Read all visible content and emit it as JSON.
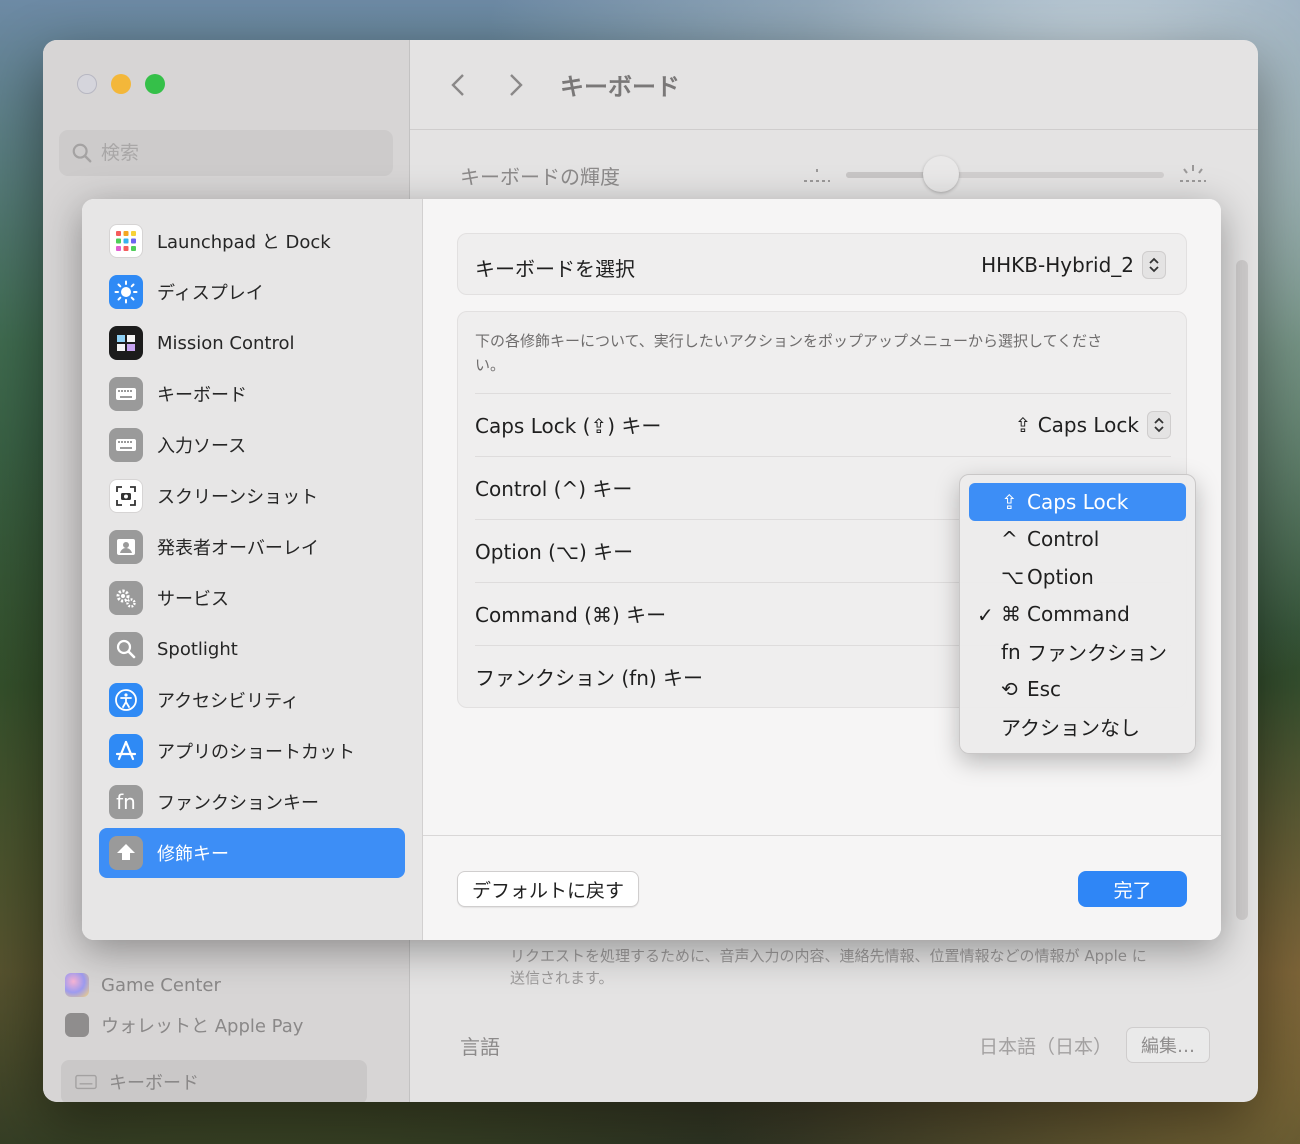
{
  "window": {
    "title": "キーボード",
    "search_placeholder": "検索",
    "brightness_label": "キーボードの輝度",
    "brightness_level": 0.3,
    "privacy_text": "リクエストを処理するために、音声入力の内容、連絡先情報、位置情報などの情報が Apple に送信されます。",
    "language_label": "言語",
    "language_value": "日本語（日本）",
    "edit_button": "編集…",
    "sidebar_items": [
      {
        "label": "Game Center",
        "icon": "game-center-icon"
      },
      {
        "label": "ウォレットと Apple Pay",
        "icon": "wallet-icon"
      }
    ],
    "sidebar_current": "キーボード"
  },
  "sheet": {
    "sidebar": [
      {
        "label": "Launchpad と Dock",
        "icon": "launchpad-icon",
        "color": "#ffffff"
      },
      {
        "label": "ディスプレイ",
        "icon": "display-icon",
        "color": "#2f8af5"
      },
      {
        "label": "Mission Control",
        "icon": "mission-control-icon",
        "color": "#1c1c1c"
      },
      {
        "label": "キーボード",
        "icon": "keyboard-icon",
        "color": "#9a9a9a"
      },
      {
        "label": "入力ソース",
        "icon": "input-source-icon",
        "color": "#9a9a9a"
      },
      {
        "label": "スクリーンショット",
        "icon": "screenshot-icon",
        "color": "#ffffff"
      },
      {
        "label": "発表者オーバーレイ",
        "icon": "presenter-overlay-icon",
        "color": "#9a9a9a"
      },
      {
        "label": "サービス",
        "icon": "services-icon",
        "color": "#9a9a9a"
      },
      {
        "label": "Spotlight",
        "icon": "spotlight-icon",
        "color": "#9a9a9a"
      },
      {
        "label": "アクセシビリティ",
        "icon": "accessibility-icon",
        "color": "#2f8af5"
      },
      {
        "label": "アプリのショートカット",
        "icon": "app-shortcuts-icon",
        "color": "#2f8af5"
      },
      {
        "label": "ファンクションキー",
        "icon": "fn-icon",
        "color": "#9a9a9a"
      },
      {
        "label": "修飾キー",
        "icon": "modifier-keys-icon",
        "color": "#9a9a9a",
        "active": true
      }
    ],
    "keyboard_select_label": "キーボードを選択",
    "keyboard_select_value": "HHKB-Hybrid_2",
    "description": "下の各修飾キーについて、実行したいアクションをポップアップメニューから選択してください。",
    "modifier_rows": [
      {
        "label": "Caps Lock (⇪) キー",
        "value": "⇪ Caps Lock"
      },
      {
        "label": "Control (^) キー",
        "value": ""
      },
      {
        "label": "Option (⌥) キー",
        "value": ""
      },
      {
        "label": "Command (⌘) キー",
        "value": ""
      },
      {
        "label": "ファンクション (fn) キー",
        "value": ""
      }
    ],
    "restore_defaults_button": "デフォルトに戻す",
    "done_button": "完了"
  },
  "menu": {
    "items": [
      {
        "glyph": "⇪",
        "label": "Caps Lock",
        "highlighted": true,
        "checked": false
      },
      {
        "glyph": "^",
        "label": "Control",
        "highlighted": false,
        "checked": false
      },
      {
        "glyph": "⌥",
        "label": "Option",
        "highlighted": false,
        "checked": false
      },
      {
        "glyph": "⌘",
        "label": "Command",
        "highlighted": false,
        "checked": true
      },
      {
        "glyph": "fn",
        "label": "ファンクション",
        "highlighted": false,
        "checked": false
      },
      {
        "glyph": "⟲",
        "label": "Esc",
        "highlighted": false,
        "checked": false
      },
      {
        "glyph": "",
        "label": "アクションなし",
        "highlighted": false,
        "checked": false
      }
    ],
    "check_mark": "✓"
  },
  "colors": {
    "accent": "#3d8ef6",
    "done_button": "#2f86f6"
  }
}
